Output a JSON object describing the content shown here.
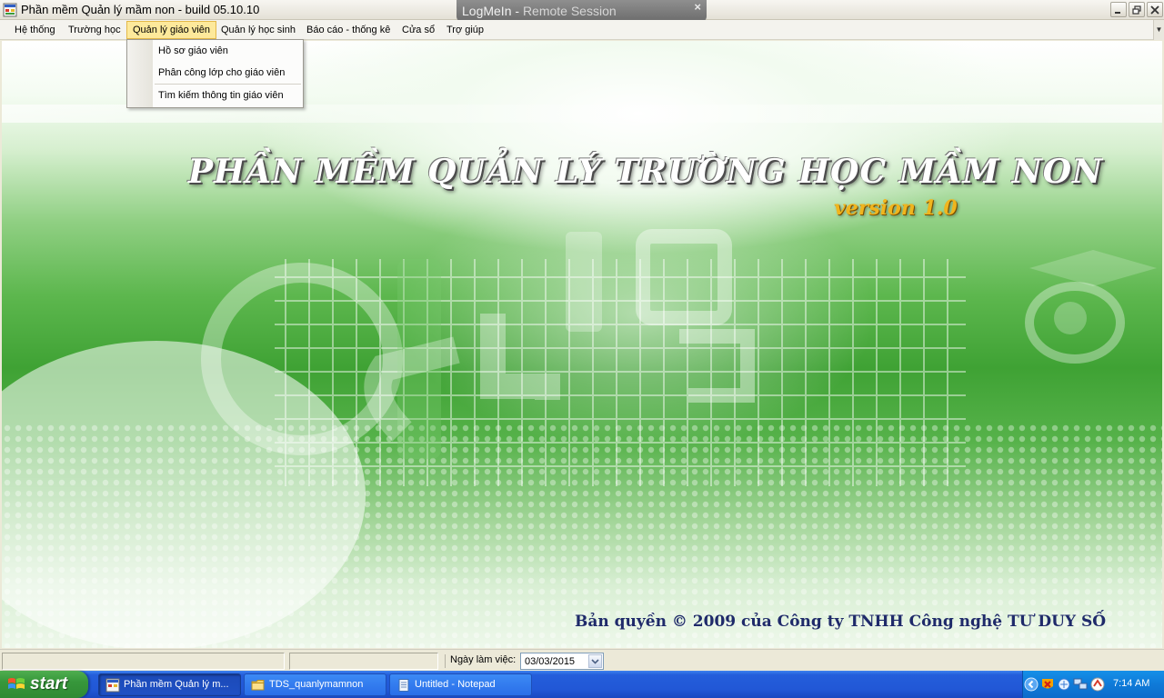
{
  "window": {
    "title": "Phần mềm Quản lý mầm non - build 05.10.10",
    "remote_session": {
      "name": "LogMeIn -",
      "label": "Remote Session"
    }
  },
  "menu": {
    "items": [
      {
        "label": "Hệ thống"
      },
      {
        "label": "Trường học"
      },
      {
        "label": "Quản lý giáo viên",
        "active": true
      },
      {
        "label": "Quản lý học sinh"
      },
      {
        "label": "Báo cáo - thống kê"
      },
      {
        "label": "Cửa sổ"
      },
      {
        "label": "Trợ giúp"
      }
    ],
    "dropdown": [
      {
        "label": "Hồ sơ giáo viên"
      },
      {
        "label": "Phân công lớp cho giáo viên"
      },
      {
        "label": "Tìm kiếm thông tin giáo viên"
      }
    ]
  },
  "splash": {
    "title": "PHẦN MỀM QUẢN LÝ TRƯỜNG HỌC MẦM NON",
    "version": "version 1.0",
    "copyright": "Bản quyền © 2009 của Công ty TNHH Công nghệ TƯ DUY SỐ"
  },
  "statusbar": {
    "date_label": "Ngày làm việc:",
    "date_value": "03/03/2015"
  },
  "taskbar": {
    "start_label": "start",
    "tasks": [
      {
        "label": "Phần mềm Quản lý m...",
        "active": true,
        "icon": "app-window-icon"
      },
      {
        "label": "TDS_quanlymamnon",
        "active": false,
        "icon": "folder-icon"
      },
      {
        "label": "Untitled - Notepad",
        "active": false,
        "icon": "notepad-icon"
      }
    ],
    "clock": "7:14 AM"
  },
  "colors": {
    "menu_active_bg": "#fde99b",
    "taskbar_blue": "#245edb",
    "start_green": "#37973b",
    "version_gold": "#f0b51e",
    "copyright_navy": "#1f2a6a"
  }
}
